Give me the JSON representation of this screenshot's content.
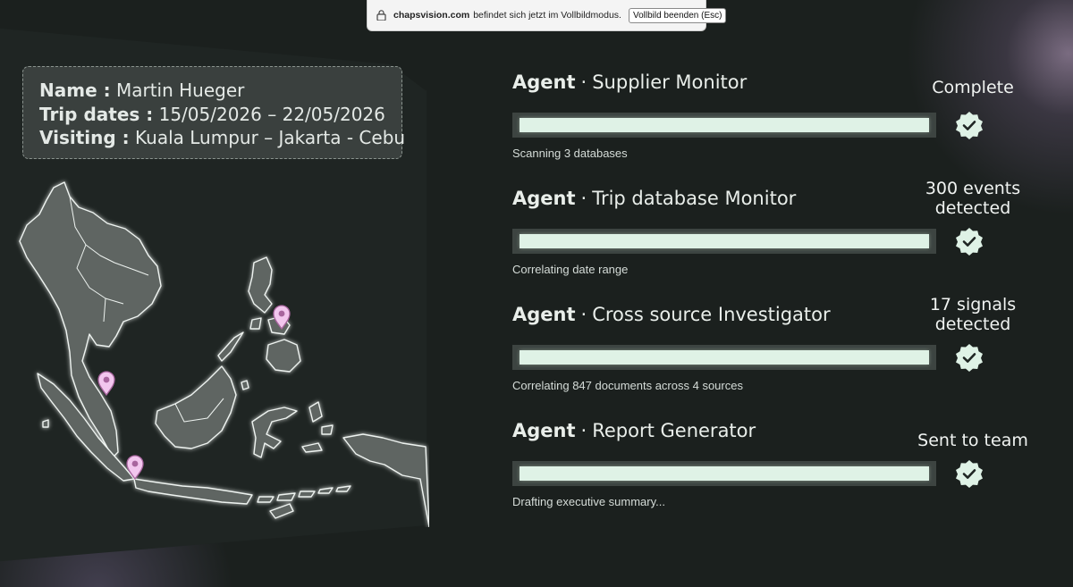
{
  "fullscreen_notice": {
    "host": "chapsvision.com",
    "message": "befindet sich jetzt im Vollbildmodus.",
    "exit_label": "Vollbild beenden (Esc)"
  },
  "traveler": {
    "name_label": "Name :",
    "name": "Martin Hueger",
    "dates_label": "Trip dates :",
    "dates": "15/05/2026 – 22/05/2026",
    "visiting_label": "Visiting :",
    "visiting": "Kuala Lumpur – Jakarta - Cebu"
  },
  "map": {
    "pins": [
      "Kuala Lumpur",
      "Jakarta",
      "Cebu"
    ],
    "pin_color": "#f2c6ee"
  },
  "agents": [
    {
      "keyword": "Agent",
      "separator": "·",
      "name": "Supplier Monitor",
      "progress": 1.0,
      "subtitle": "Scanning 3 databases",
      "status": "Complete",
      "status_icon": "check-badge-icon"
    },
    {
      "keyword": "Agent",
      "separator": "·",
      "name": "Trip database Monitor",
      "progress": 1.0,
      "subtitle": "Correlating date range",
      "status": "300 events detected",
      "status_icon": "check-badge-icon"
    },
    {
      "keyword": "Agent",
      "separator": "·",
      "name": "Cross source Investigator",
      "progress": 1.0,
      "subtitle": "Correlating 847 documents across 4 sources",
      "status": "17 signals detected",
      "status_icon": "check-badge-icon"
    },
    {
      "keyword": "Agent",
      "separator": "·",
      "name": "Report Generator",
      "progress": 1.0,
      "subtitle": "Drafting executive summary...",
      "status": "Sent to team",
      "status_icon": "check-badge-icon"
    }
  ],
  "colors": {
    "background": "#1b201e",
    "bar_fill": "#dff2e6",
    "bar_track": "#3d4441",
    "badge": "#dff2e6"
  }
}
